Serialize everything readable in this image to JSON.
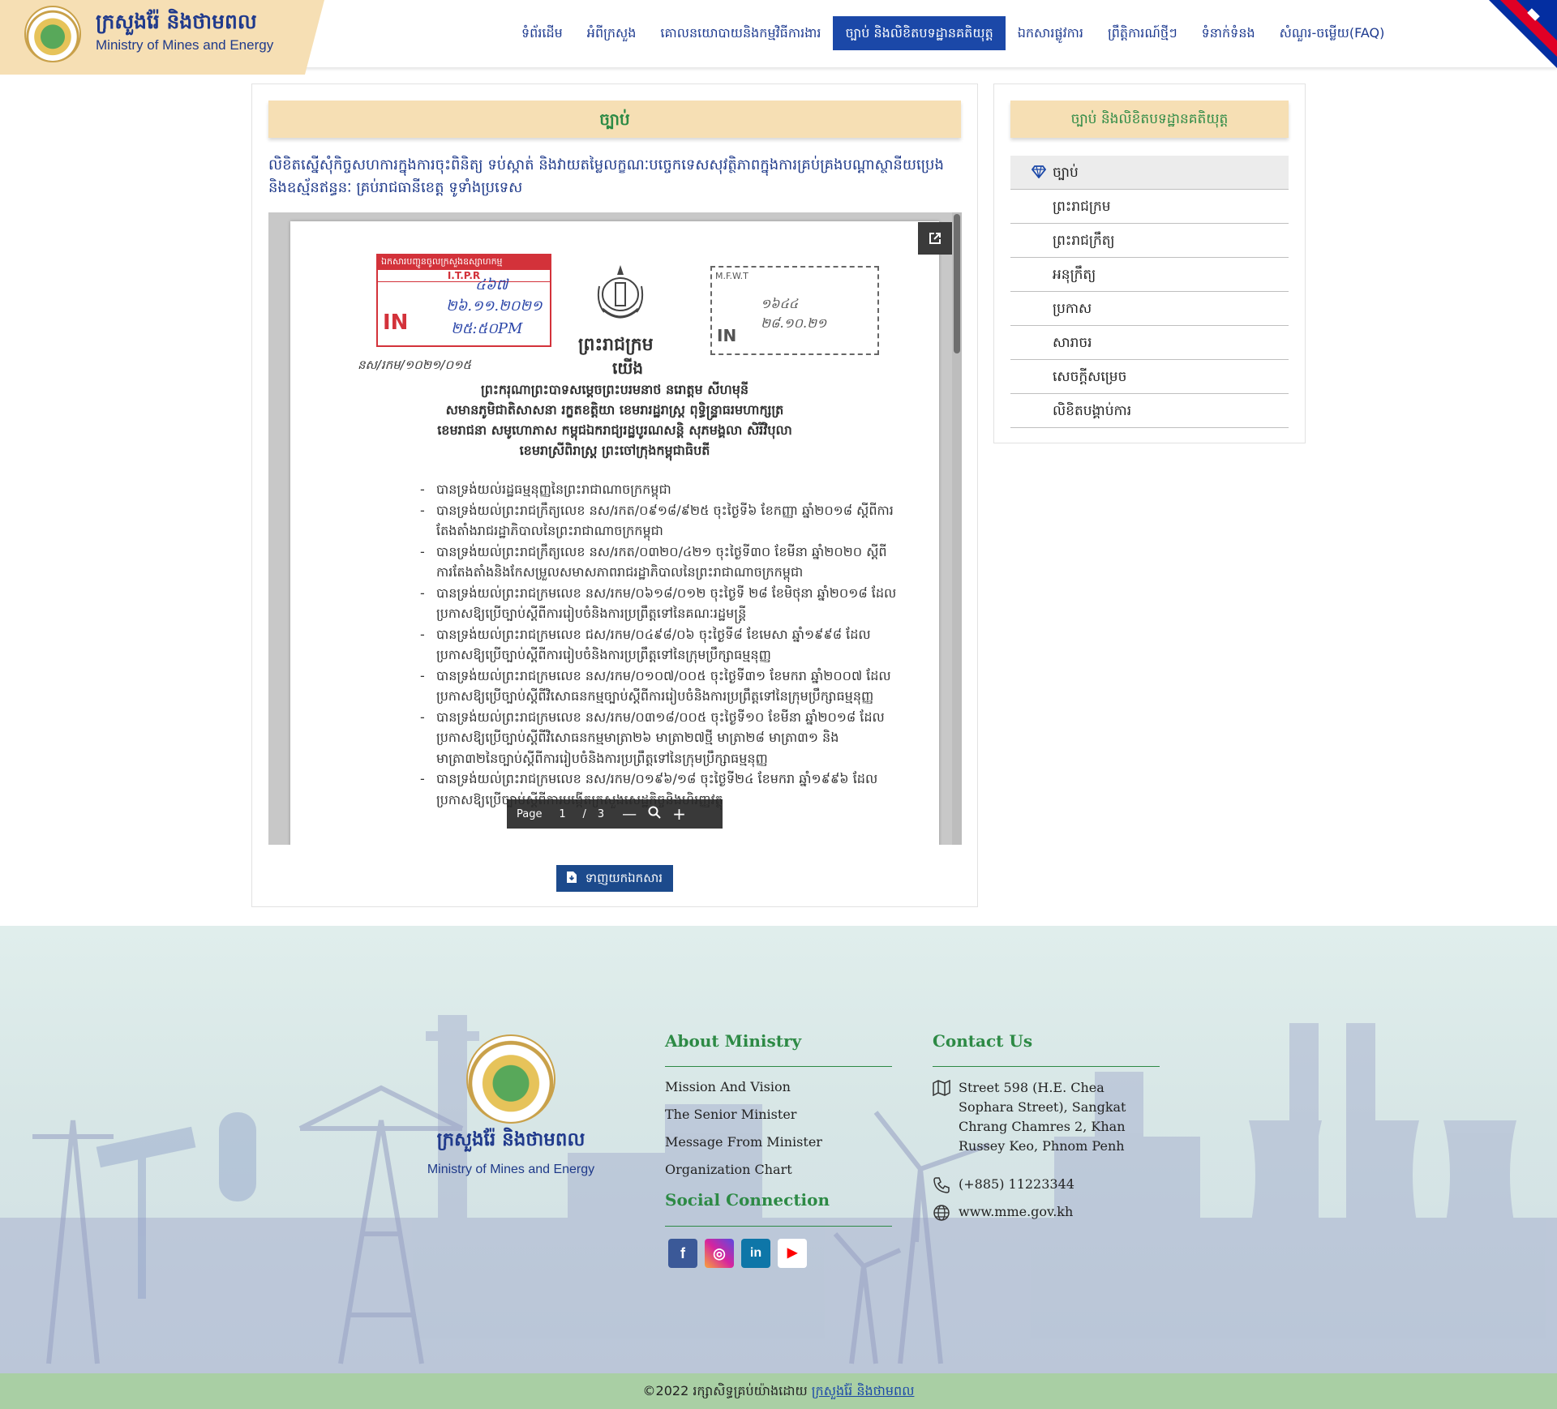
{
  "header": {
    "brand_kh": "ក្រសួងរ៉ែ និងថាមពល",
    "brand_en": "Ministry of Mines and Energy",
    "logo_icon": "ministry-logo-icon",
    "nav": [
      {
        "label": "ទំព័រដើម",
        "active": false
      },
      {
        "label": "អំពីក្រសួង",
        "active": false
      },
      {
        "label": "គោលនយោបាយនិងកម្មវិធីការងារ",
        "active": false
      },
      {
        "label": "ច្បាប់ និងលិខិតបទដ្ឋានគតិយុត្ត",
        "active": true
      },
      {
        "label": "ឯកសារផ្លូវការ",
        "active": false
      },
      {
        "label": "ព្រឹត្តិការណ៍ថ្មីៗ",
        "active": false
      },
      {
        "label": "ទំនាក់ទំនង",
        "active": false
      },
      {
        "label": "សំណួរ-ចម្លើយ(FAQ)",
        "active": false
      }
    ],
    "flag_icon": "cambodia-flag-icon"
  },
  "main": {
    "title": "ច្បាប់",
    "description": "លិខិតស្នើសុំកិច្ចសហការក្នុងការចុះពិនិត្យ ទប់ស្កាត់ និងវាយតម្លៃលក្ខណៈបច្ចេកទេសសុវត្ថិភាពក្នុងការគ្រប់គ្រងបណ្តាស្ថានីយប្រេង និងឧស្ម័នឥន្ធនៈ គ្រប់រាជធានីខេត្ត ទូទាំងប្រទេស",
    "viewer": {
      "popout_icon": "open-external-icon",
      "page_label": "Page",
      "current_page": "1",
      "separator": "/",
      "total_pages": "3",
      "zoom_out_icon": "minus-icon",
      "zoom_icon": "zoom-icon",
      "zoom_in_icon": "plus-icon",
      "document": {
        "stamp_left_header": "ឯកសារបញ្ជូនចូលក្រសួងឧស្សាហកម្ម",
        "stamp_left_org": "I.T.P.R",
        "stamp_left_in": "IN",
        "stamp_left_no": "៤៦៧",
        "stamp_left_date": "២៦.១១.២០២១",
        "stamp_left_time": "២៥:៥០PM",
        "stamp_right_org": "M.F.W.T",
        "stamp_right_in": "IN",
        "stamp_right_no": "១៦៤៤",
        "stamp_right_date": "២៨.១០.២១",
        "emblem_icon": "royal-emblem-icon",
        "decree_title": "ព្រះរាជក្រម",
        "decree_we": "យើង",
        "decree_number": "នស/រកម/១០២១/០១៥",
        "royal_lines": [
          "ព្រះករុណាព្រះបាទសម្តេចព្រះបរមនាថ នរោត្តម សីហមុនី",
          "សមានភូមិជាតិសាសនា រក្ខតខត្តិយា ខេមរារដ្ឋរាស្ត្រ ពុទ្ធិន្ទ្រាធរមហាក្សត្រ",
          "ខេមរាជនា សមូហោភាស កម្ពុជឯករាជ្យរដ្ឋបូរណសន្តិ សុភមង្គលា សិរីវិបុលា",
          "ខេមរាស្រីពិរាស្ត្រ ព្រះចៅក្រុងកម្ពុជាធិបតី"
        ],
        "clauses": [
          "បានទ្រង់យល់រដ្ឋធម្មនុញ្ញនៃព្រះរាជាណាចក្រកម្ពុជា",
          "បានទ្រង់យល់ព្រះរាជក្រឹត្យលេខ នស/រកត/០៩១៨/៩២៥ ចុះថ្ងៃទី៦ ខែកញ្ញា ឆ្នាំ២០១៨ ស្តីពីការតែងតាំងរាជរដ្ឋាភិបាលនៃព្រះរាជាណាចក្រកម្ពុជា",
          "បានទ្រង់យល់ព្រះរាជក្រឹត្យលេខ នស/រកត/០៣២០/៤២១ ចុះថ្ងៃទី៣០ ខែមីនា ឆ្នាំ២០២០ ស្តីពីការតែងតាំងនិងកែសម្រួលសមាសភាពរាជរដ្ឋាភិបាលនៃព្រះរាជាណាចក្រកម្ពុជា",
          "បានទ្រង់យល់ព្រះរាជក្រមលេខ នស/រកម/០៦១៨/០១២ ចុះថ្ងៃទី ២៨ ខែមិថុនា ឆ្នាំ២០១៨ ដែលប្រកាសឱ្យប្រើច្បាប់ស្តីពីការរៀបចំនិងការប្រព្រឹត្តទៅនៃគណៈរដ្ឋមន្ត្រី",
          "បានទ្រង់យល់ព្រះរាជក្រមលេខ ជស/រកម/០៤៩៨/០៦ ចុះថ្ងៃទី៨ ខែមេសា ឆ្នាំ១៩៩៨ ដែលប្រកាសឱ្យប្រើច្បាប់ស្តីពីការរៀបចំនិងការប្រព្រឹត្តទៅនៃក្រុមប្រឹក្សាធម្មនុញ្ញ",
          "បានទ្រង់យល់ព្រះរាជក្រមលេខ នស/រកម/០១០៧/០០៥ ចុះថ្ងៃទី៣១ ខែមករា ឆ្នាំ២០០៧ ដែលប្រកាសឱ្យប្រើច្បាប់ស្តីពីវិសោធនកម្មច្បាប់ស្តីពីការរៀបចំនិងការប្រព្រឹត្តទៅនៃក្រុមប្រឹក្សាធម្មនុញ្ញ",
          "បានទ្រង់យល់ព្រះរាជក្រមលេខ នស/រកម/០៣១៨/០០៥ ចុះថ្ងៃទី១០ ខែមីនា ឆ្នាំ២០១៨ ដែលប្រកាសឱ្យប្រើច្បាប់ស្តីពីវិសោធនកម្មមាត្រា២៦ មាត្រា២៧ថ្មី មាត្រា២៨ មាត្រា៣១ និងមាត្រា៣២នៃច្បាប់ស្តីពីការរៀបចំនិងការប្រព្រឹត្តទៅនៃក្រុមប្រឹក្សាធម្មនុញ្ញ",
          "បានទ្រង់យល់ព្រះរាជក្រមលេខ នស/រកម/០១៩៦/១៨ ចុះថ្ងៃទី២៤ ខែមករា ឆ្នាំ១៩៩៦ ដែលប្រកាសឱ្យប្រើច្បាប់ស្តីពីការបង្កើតក្រសួងសេដ្ឋកិច្ចនិងហិរញ្ញវត្ថុ"
        ]
      }
    },
    "download_label": "ទាញយកឯកសារ",
    "download_icon": "file-download-icon"
  },
  "sidebar": {
    "title": "ច្បាប់ និងលិខិតបទដ្ឋានគតិយុត្ត",
    "active_icon": "gem-icon",
    "items": [
      {
        "label": "ច្បាប់",
        "active": true
      },
      {
        "label": "ព្រះរាជក្រម",
        "active": false
      },
      {
        "label": "ព្រះរាជក្រឹត្យ",
        "active": false
      },
      {
        "label": "អនុក្រឹត្យ",
        "active": false
      },
      {
        "label": "ប្រកាស",
        "active": false
      },
      {
        "label": "សារាចរ",
        "active": false
      },
      {
        "label": "សេចក្តីសម្រេច",
        "active": false
      },
      {
        "label": "លិខិតបង្គាប់ការ",
        "active": false
      }
    ]
  },
  "footer": {
    "brand_kh": "ក្រសួងរ៉ែ និងថាមពល",
    "brand_en": "Ministry of Mines and Energy",
    "about_title": "About Ministry",
    "about_links": [
      "Mission And Vision",
      "The Senior Minister",
      "Message From Minister",
      "Organization Chart"
    ],
    "social_title": "Social Connection",
    "social": [
      {
        "name": "facebook-icon",
        "glyph": "f",
        "color": "#3b5998"
      },
      {
        "name": "instagram-icon",
        "glyph": "◎",
        "color": "#d6249f"
      },
      {
        "name": "linkedin-icon",
        "glyph": "in",
        "color": "#0e76a8"
      },
      {
        "name": "youtube-icon",
        "glyph": "▶",
        "color": "#ff0000"
      }
    ],
    "contact_title": "Contact Us",
    "address": "Street 598 (H.E. Chea Sophara Street), Sangkat Chrang Chamres 2, Khan Russey Keo, Phnom Penh",
    "phone": "(+885) 11223344",
    "website": "www.mme.gov.kh",
    "copyright_prefix": "©2022 រក្សាសិទ្ធគ្រប់យ៉ាងដោយ",
    "copyright_link": "ក្រសួងរ៉ែ និងថាមពល"
  },
  "colors": {
    "brand_blue": "#1b48a8",
    "brand_green": "#2d8a45",
    "cream": "#f6dfb4",
    "footer_bar": "#a9cfa4"
  }
}
